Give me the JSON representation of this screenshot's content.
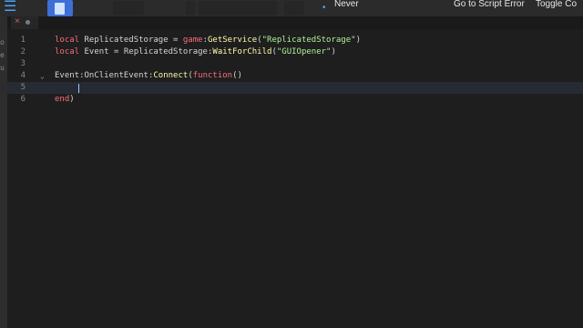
{
  "toolbar": {
    "never_label": "Never",
    "goto_label": "Go to Script Error",
    "toggle_label": "Toggle Co",
    "bullet": "•",
    "menu_glyph": "☰"
  },
  "left_strip": {
    "chars": [
      "o",
      "e",
      "u"
    ]
  },
  "tab": {
    "close_glyph": "×"
  },
  "code_lines": [
    {
      "num": "1",
      "tokens": [
        [
          "kw",
          "local"
        ],
        [
          "tx",
          " ReplicatedStorage = "
        ],
        [
          "kw",
          "game"
        ],
        [
          "tx",
          ":"
        ],
        [
          "fn",
          "GetService"
        ],
        [
          "tx",
          "("
        ],
        [
          "str",
          "\"ReplicatedStorage\""
        ],
        [
          "tx",
          ")"
        ]
      ]
    },
    {
      "num": "2",
      "tokens": [
        [
          "kw",
          "local"
        ],
        [
          "tx",
          " Event = ReplicatedStorage:"
        ],
        [
          "fn",
          "WaitForChild"
        ],
        [
          "tx",
          "("
        ],
        [
          "str",
          "\"GUIOpener\""
        ],
        [
          "tx",
          ")"
        ]
      ]
    },
    {
      "num": "3",
      "tokens": []
    },
    {
      "num": "4",
      "tokens": [
        [
          "tx",
          "Event:OnClientEvent:"
        ],
        [
          "fn",
          "Connect"
        ],
        [
          "tx",
          "("
        ],
        [
          "kw",
          "function"
        ],
        [
          "tx",
          "()"
        ]
      ]
    },
    {
      "num": "5",
      "tokens": []
    },
    {
      "num": "6",
      "tokens": [
        [
          "kw",
          "end"
        ],
        [
          "tx",
          ")"
        ]
      ]
    }
  ],
  "fold_glyph": "⌄",
  "colors": {
    "keyword": "#f86d7c",
    "function": "#fdfbac",
    "string": "#adf195",
    "text": "#d4d4d4",
    "background": "#1e1e1e"
  }
}
